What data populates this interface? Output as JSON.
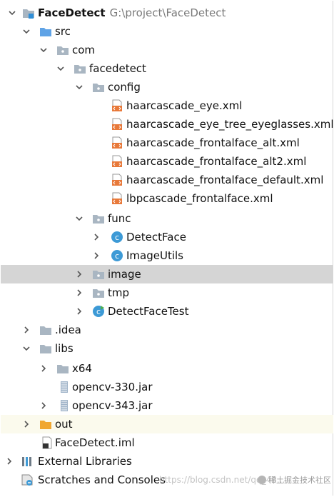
{
  "project": {
    "name": "FaceDetect",
    "path": "G:\\project\\FaceDetect"
  },
  "tree": {
    "src": "src",
    "com": "com",
    "facedetect": "facedetect",
    "config": "config",
    "files": [
      "haarcascade_eye.xml",
      "haarcascade_eye_tree_eyeglasses.xml",
      "haarcascade_frontalface_alt.xml",
      "haarcascade_frontalface_alt2.xml",
      "haarcascade_frontalface_default.xml",
      "lbpcascade_frontalface.xml"
    ],
    "func": "func",
    "detect_face": "DetectFace",
    "image_utils": "ImageUtils",
    "image": "image",
    "tmp": "tmp",
    "detect_face_test": "DetectFaceTest",
    "idea": ".idea",
    "libs": "libs",
    "x64": "x64",
    "opencv330": "opencv-330.jar",
    "opencv343": "opencv-343.jar",
    "out": "out",
    "iml": "FaceDetect.iml",
    "external_libraries": "External Libraries",
    "scratches": "Scratches and Consoles"
  },
  "watermark": {
    "csdn": "https://blog.csdn.net/qq_43...",
    "juejin": "稀土掘金技术社区"
  },
  "colors": {
    "selected": "#d5d5d5",
    "excluded": "#fbfaed",
    "folder": "#a9b6c2",
    "excluded_folder": "#f0a732",
    "xml": "#e8793a",
    "class": "#3d9ad6"
  }
}
